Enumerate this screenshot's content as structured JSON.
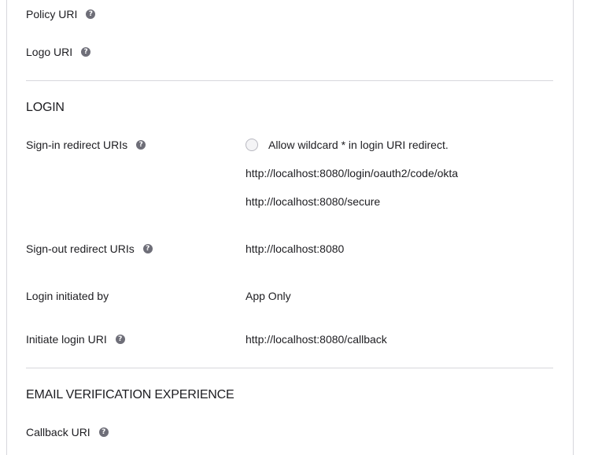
{
  "general": {
    "policy_uri_label": "Policy URI",
    "logo_uri_label": "Logo URI"
  },
  "login": {
    "section_title": "LOGIN",
    "signin_label": "Sign-in redirect URIs",
    "wildcard_label": "Allow wildcard * in login URI redirect.",
    "wildcard_checked": false,
    "signin_uris": [
      "http://localhost:8080/login/oauth2/code/okta",
      "http://localhost:8080/secure"
    ],
    "signout_label": "Sign-out redirect URIs",
    "signout_uri": "http://localhost:8080",
    "initiated_by_label": "Login initiated by",
    "initiated_by_value": "App Only",
    "initiate_uri_label": "Initiate login URI",
    "initiate_uri_value": "http://localhost:8080/callback"
  },
  "email_verification": {
    "section_title": "EMAIL VERIFICATION EXPERIENCE",
    "callback_label": "Callback URI"
  },
  "icons": {
    "help": "question-mark-circle-icon",
    "help_glyph": "?"
  },
  "colors": {
    "text": "#1d1d21",
    "help_icon_bg": "#6e6e78",
    "divider": "#d7d7dc"
  }
}
